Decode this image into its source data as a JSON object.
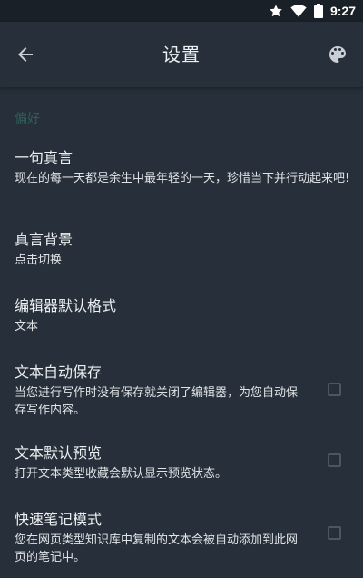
{
  "status_bar": {
    "time": "9:27",
    "icons": [
      "star-icon",
      "wifi-icon",
      "battery-icon"
    ]
  },
  "app_bar": {
    "title": "设置",
    "back_icon": "arrow-left-icon",
    "palette_icon": "palette-icon"
  },
  "section": {
    "header": "偏好"
  },
  "preferences": [
    {
      "title": "一句真言",
      "summary": "现在的每一天都是余生中最年轻的一天，珍惜当下并行动起来吧!"
    },
    {
      "title": "真言背景",
      "summary": "点击切换"
    },
    {
      "title": "编辑器默认格式",
      "summary": "文本"
    },
    {
      "title": "文本自动保存",
      "summary": "当您进行写作时没有保存就关闭了编辑器，为您自动保存写作内容。",
      "checked": false
    },
    {
      "title": "文本默认预览",
      "summary": "打开文本类型收藏会默认显示预览状态。",
      "checked": false
    },
    {
      "title": "快速笔记模式",
      "summary": "您在网页类型知识库中复制的文本会被自动添加到此网页的笔记中。",
      "checked": false
    }
  ],
  "colors": {
    "background": "#27303a",
    "status_bar": "#1a2027",
    "section_header": "#2e5f56",
    "text_primary": "#eceff1",
    "checkbox_border": "#4c5660"
  }
}
